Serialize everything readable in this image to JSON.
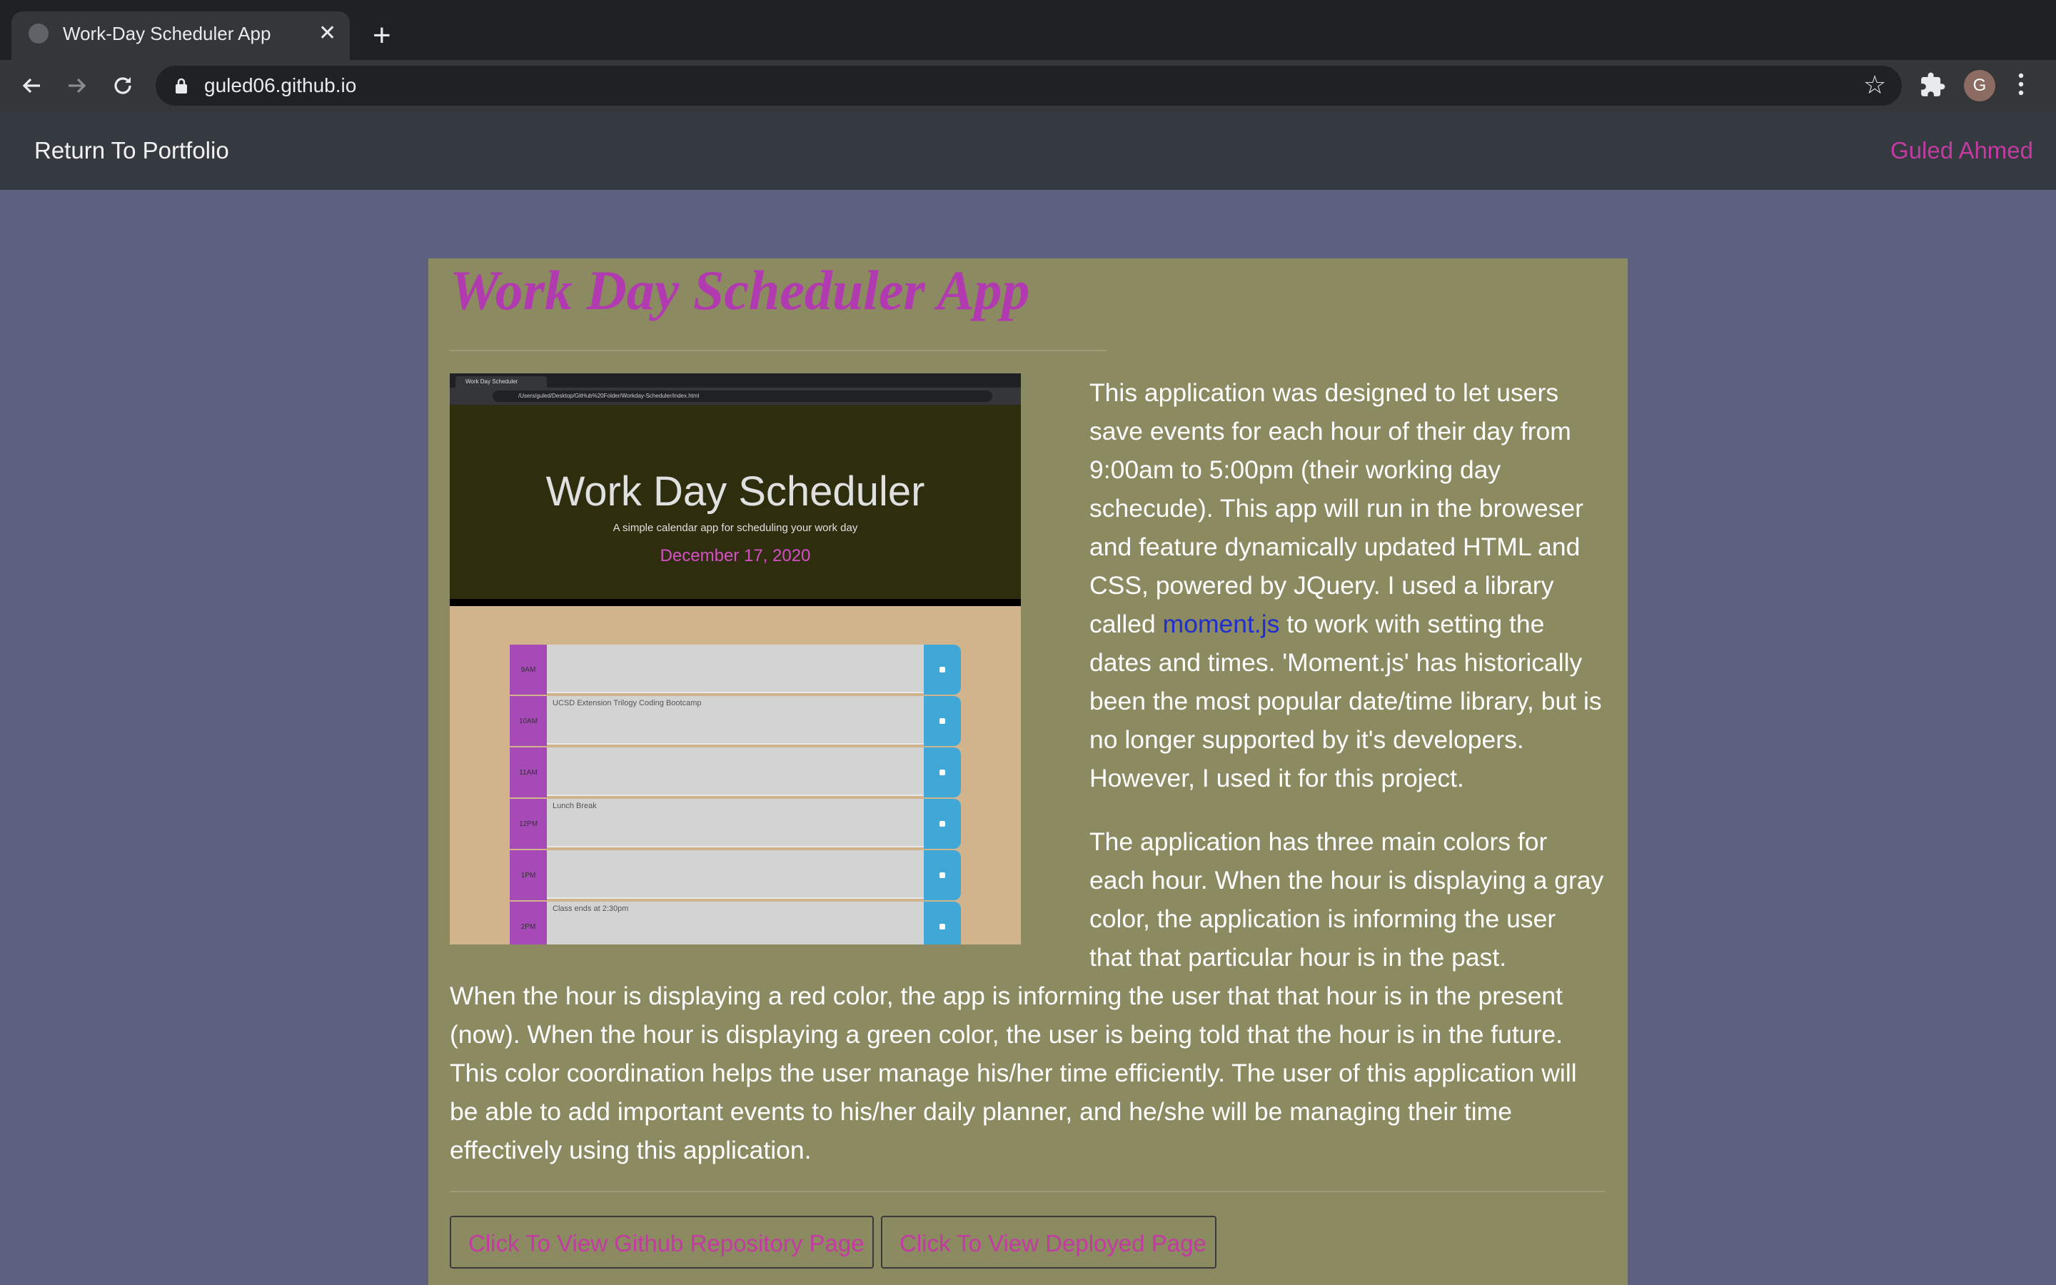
{
  "browser": {
    "tab_title": "Work-Day Scheduler App",
    "tab_close": "✕",
    "new_tab": "+",
    "url": "guled06.github.io",
    "profile_initial": "G"
  },
  "navbar": {
    "left_link": "Return To Portfolio",
    "right_link": "Guled Ahmed"
  },
  "main": {
    "title": "Work Day Scheduler App",
    "preview": {
      "tab_title": "Work Day Scheduler",
      "url": "/Users/guled/Desktop/GitHub%20Folder/Workday-Scheduler/index.html",
      "heading": "Work Day Scheduler",
      "subheading": "A simple calendar app for scheduling your work day",
      "date": "December 17, 2020",
      "rows": [
        {
          "hour": "9AM",
          "text": ""
        },
        {
          "hour": "10AM",
          "text": "UCSD Extension Trilogy Coding Bootcamp"
        },
        {
          "hour": "11AM",
          "text": ""
        },
        {
          "hour": "12PM",
          "text": "Lunch Break"
        },
        {
          "hour": "1PM",
          "text": ""
        },
        {
          "hour": "2PM",
          "text": "Class ends at 2:30pm"
        }
      ]
    },
    "paragraph1_before_link": "This application was designed to let users save events for each hour of their day from 9:00am to 5:00pm (their working day schecude). This app will run in the broweser and feature dynamically updated HTML and CSS, powered by JQuery. I used a library called ",
    "paragraph1_link": "moment.js",
    "paragraph1_after_link": " to work with setting the dates and times. 'Moment.js' has historically been the most popular date/time library, but is no longer supported by it's developers. However, I used it for this project.",
    "paragraph2_part1": "The application has three main colors for each hour. When the hour is displaying a gray color, the application is informing the user that that particular hour is in the past.",
    "paragraph2_part2": "When the hour is displaying a red color, the app is informing the user that that hour is in the present (now). When the hour is displaying a green color, the user is being told that the hour is in the future. This color coordination helps the user manage his/her time efficiently. The user of this application will be able to add important events to his/her daily planner, and he/she will be managing their time effectively using this application.",
    "button_repo": "Click To View Github Repository Page",
    "button_deployed": "Click To View Deployed Page"
  },
  "colors": {
    "page_bg": "#5e6080",
    "card_bg": "#8b8a61",
    "accent": "#c43aa3",
    "link": "#1f2ecc"
  }
}
